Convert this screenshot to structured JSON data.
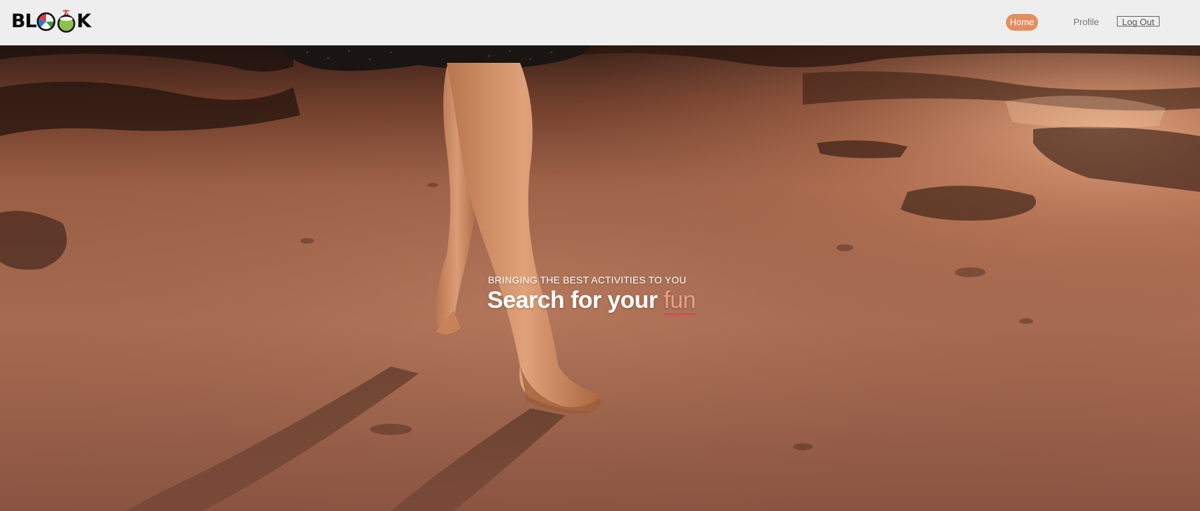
{
  "navbar": {
    "logo": {
      "text_before": "BL",
      "text_after": "K",
      "full_text": "BLOOOK",
      "icons": [
        "beach-ball-icon",
        "coconut-drink-icon"
      ]
    },
    "home_label": "Home",
    "profile_label": "Profile",
    "logout_label": "Log Out",
    "active_item": "Home"
  },
  "hero": {
    "subtitle": "BRINGING THE BEST ACTIVITIES TO YOU",
    "title_prefix": "Search for your",
    "title_accent": "fun",
    "background": "beach-sunset-walking-photo"
  },
  "colors": {
    "navbar_bg": "#eeeeee",
    "accent": "#e48d5e",
    "title_accent": "#e8a085",
    "underline": "#d8425a"
  }
}
